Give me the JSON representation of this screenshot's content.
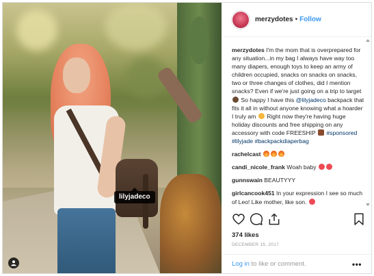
{
  "post": {
    "username": "merzydotes",
    "follow_label": "Follow",
    "photo_tag": "lilyjadeco",
    "caption": {
      "user": "merzydotes",
      "text1": "I'm the mom that is overprepared for any situation...in my bag I always have way too many diapers, enough toys to keep an army of children occupied, snacks on snacks on snacks, two or three changes of clothes, did I mention snacks? Even if we're just going on a trip to target",
      "text2": "So happy I have this",
      "mention": "@lilyjadeco",
      "text3": "backpack that fits it all in without anyone knowing what a hoarder I truly am",
      "text4": "Right now they're having huge holiday discounts and free shipping on any accessory with code FREESHIP",
      "hashtags": "#sponsored #lilyjade #backpackdiaperbag"
    },
    "comments": [
      {
        "user": "rachelcast",
        "text": "",
        "emoji": [
          "fire",
          "fire",
          "fire"
        ]
      },
      {
        "user": "candi_nicole_frank",
        "text": "Woah baby",
        "emoji": [
          "heart",
          "heart"
        ]
      },
      {
        "user": "gunnswain",
        "text": "BEAUTYYY",
        "emoji": []
      },
      {
        "user": "girlcancook451",
        "text": "In your expression I see so much of Leo! Like mother, like son.",
        "emoji": [
          "face"
        ]
      }
    ],
    "likes": "374 likes",
    "date": "DECEMBER 15, 2017",
    "login_link": "Log in",
    "login_text": "to like or comment.",
    "more_label": "•••"
  },
  "colors": {
    "accent": "#3897f0",
    "text": "#262626",
    "muted": "#999999",
    "border": "#dbdbdb"
  },
  "icons": [
    "heart-icon",
    "comment-icon",
    "share-icon",
    "bookmark-icon",
    "user-tag-icon",
    "more-icon"
  ]
}
